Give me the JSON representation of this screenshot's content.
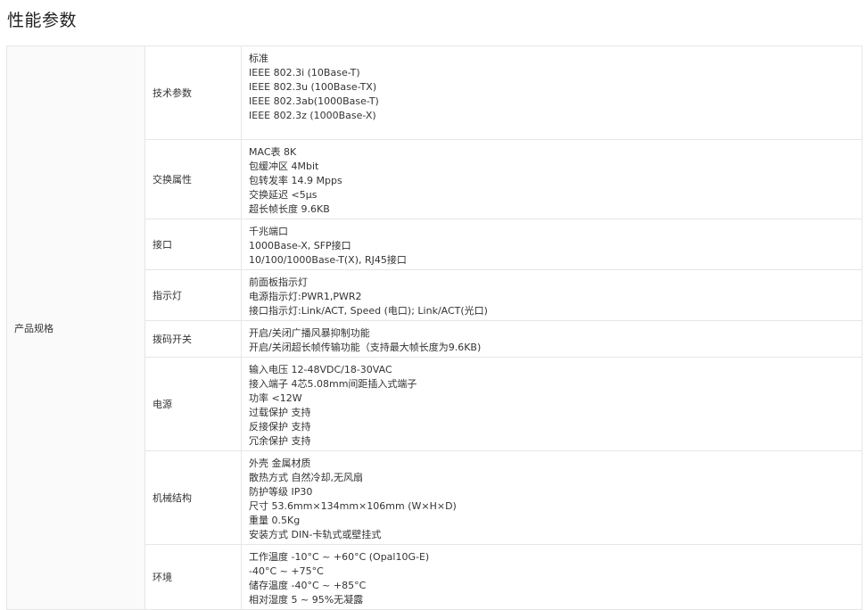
{
  "page": {
    "title": "性能参数"
  },
  "spec": {
    "category": "产品规格",
    "rows": [
      {
        "label": "技术参数",
        "lines": [
          "标准",
          "IEEE 802.3i (10Base-T)",
          "IEEE 802.3u (100Base-TX)",
          "IEEE 802.3ab(1000Base-T)",
          "IEEE 802.3z (1000Base-X)"
        ]
      },
      {
        "label": "交换属性",
        "lines": [
          "MAC表 8K",
          "包缓冲区 4Mbit",
          "包转发率 14.9 Mpps",
          "交换延迟 <5μs",
          "超长帧长度 9.6KB"
        ]
      },
      {
        "label": "接口",
        "lines": [
          "千兆端口",
          "1000Base-X, SFP接口",
          "10/100/1000Base-T(X), RJ45接口"
        ]
      },
      {
        "label": "指示灯",
        "lines": [
          "前面板指示灯",
          "电源指示灯:PWR1,PWR2",
          "接口指示灯:Link/ACT, Speed (电口); Link/ACT(光口)"
        ]
      },
      {
        "label": "拨码开关",
        "lines": [
          "开启/关闭广播风暴抑制功能",
          "开启/关闭超长帧传输功能（支持最大帧长度为9.6KB)"
        ]
      },
      {
        "label": "电源",
        "lines": [
          "输入电压 12-48VDC/18-30VAC",
          "接入端子 4芯5.08mm间距插入式端子",
          "功率 <12W",
          "过载保护 支持",
          "反接保护 支持",
          "冗余保护 支持"
        ]
      },
      {
        "label": "机械结构",
        "lines": [
          "外壳 金属材质",
          "散热方式 自然冷却,无风扇",
          "防护等级 IP30",
          "尺寸 53.6mm×134mm×106mm (W×H×D)",
          "重量 0.5Kg",
          "安装方式 DIN-卡轨式或壁挂式"
        ]
      },
      {
        "label": "环境",
        "lines": [
          "工作温度 -10°C ~ +60°C (Opal10G-E)",
          "-40°C ~ +75°C",
          "储存温度 -40°C ~ +85°C",
          "相对湿度 5 ~ 95%无凝露"
        ]
      }
    ]
  }
}
